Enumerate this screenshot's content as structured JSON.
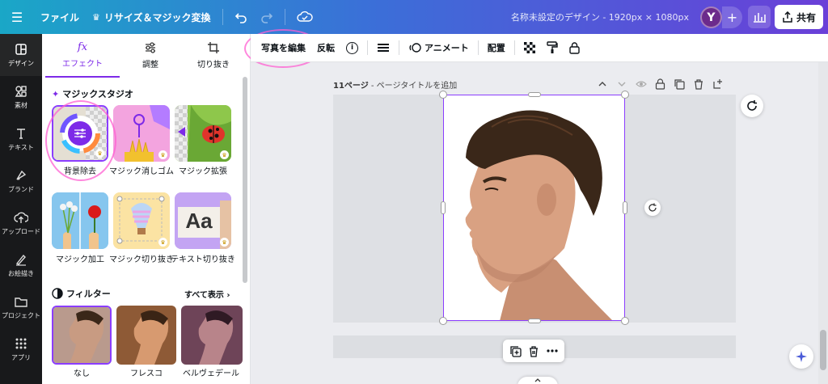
{
  "topbar": {
    "file_label": "ファイル",
    "resize_label": "リサイズ＆マジック変換",
    "doc_title": "名称未設定のデザイン - 1920px × 1080px",
    "avatar_initial": "Y",
    "plus": "+",
    "share_label": "共有"
  },
  "rail": {
    "items": [
      {
        "label": "デザイン",
        "icon": "design-icon"
      },
      {
        "label": "素材",
        "icon": "elements-icon"
      },
      {
        "label": "テキスト",
        "icon": "text-icon"
      },
      {
        "label": "ブランド",
        "icon": "brand-icon"
      },
      {
        "label": "アップロード",
        "icon": "upload-icon"
      },
      {
        "label": "お絵描き",
        "icon": "draw-icon"
      },
      {
        "label": "プロジェクト",
        "icon": "folder-icon"
      },
      {
        "label": "アプリ",
        "icon": "apps-icon"
      }
    ]
  },
  "panel": {
    "tabs": [
      {
        "label": "エフェクト",
        "icon_text": "fx"
      },
      {
        "label": "調整"
      },
      {
        "label": "切り抜き"
      }
    ],
    "magic_studio_title": "マジックスタジオ",
    "magic_tools": [
      {
        "label": "背景除去"
      },
      {
        "label": "マジック消しゴム"
      },
      {
        "label": "マジック拡張"
      },
      {
        "label": "マジック加工"
      },
      {
        "label": "マジック切り抜き"
      },
      {
        "label": "テキスト切り抜き"
      }
    ],
    "text_tile_sample": "Aa",
    "filters_title": "フィルター",
    "see_all": "すべて表示 ›",
    "filters": [
      {
        "label": "なし"
      },
      {
        "label": "フレスコ"
      },
      {
        "label": "ベルヴェデール"
      }
    ]
  },
  "toolbar": {
    "edit_photo": "写真を編集",
    "flip": "反転",
    "info": "i",
    "animate": "アニメート",
    "position": "配置"
  },
  "canvas": {
    "page_label": "11ページ",
    "page_title_placeholder": " - ページタイトルを追加"
  },
  "colors": {
    "accent": "#7d2ae8",
    "topbar_start": "#1aa7c7",
    "topbar_end": "#6a3fd8",
    "highlight": "#ff5fd2"
  }
}
